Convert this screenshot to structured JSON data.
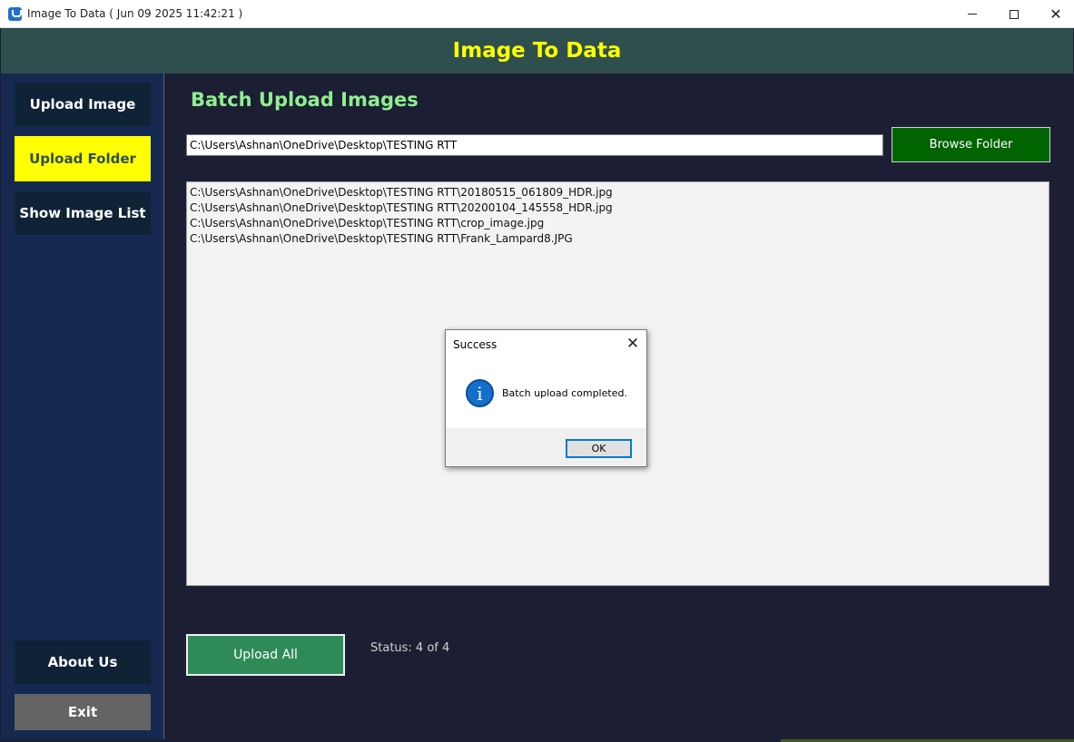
{
  "window": {
    "title": "Image To Data ( Jun 09 2025 11:42:21 )",
    "minimize_icon": "minimize-icon",
    "maximize_icon": "maximize-icon",
    "close_label": "✕"
  },
  "header": {
    "title": "Image To Data",
    "title_color": "#ffff00",
    "background": "#2f4f4f"
  },
  "sidebar": {
    "items": [
      {
        "label": "Upload Image"
      },
      {
        "label": "Upload Folder",
        "active": true,
        "active_color": "#ffff00"
      },
      {
        "label": "Show Image List"
      },
      {
        "label": "About Us"
      },
      {
        "label": "Exit"
      }
    ]
  },
  "main": {
    "title": "Batch Upload Images",
    "folder_path": "C:\\Users\\Ashnan\\OneDrive\\Desktop\\TESTING RTT",
    "browse_label": "Browse Folder",
    "files": [
      "C:\\Users\\Ashnan\\OneDrive\\Desktop\\TESTING RTT\\20180515_061809_HDR.jpg",
      "C:\\Users\\Ashnan\\OneDrive\\Desktop\\TESTING RTT\\20200104_145558_HDR.jpg",
      "C:\\Users\\Ashnan\\OneDrive\\Desktop\\TESTING RTT\\crop_image.jpg",
      "C:\\Users\\Ashnan\\OneDrive\\Desktop\\TESTING RTT\\Frank_Lampard8.JPG"
    ],
    "upload_all_label": "Upload All",
    "status": "Status: 4 of 4"
  },
  "dialog": {
    "title": "Success",
    "message": "Batch upload completed.",
    "ok_label": "OK",
    "icon": "info-icon",
    "close_label": "✕"
  }
}
